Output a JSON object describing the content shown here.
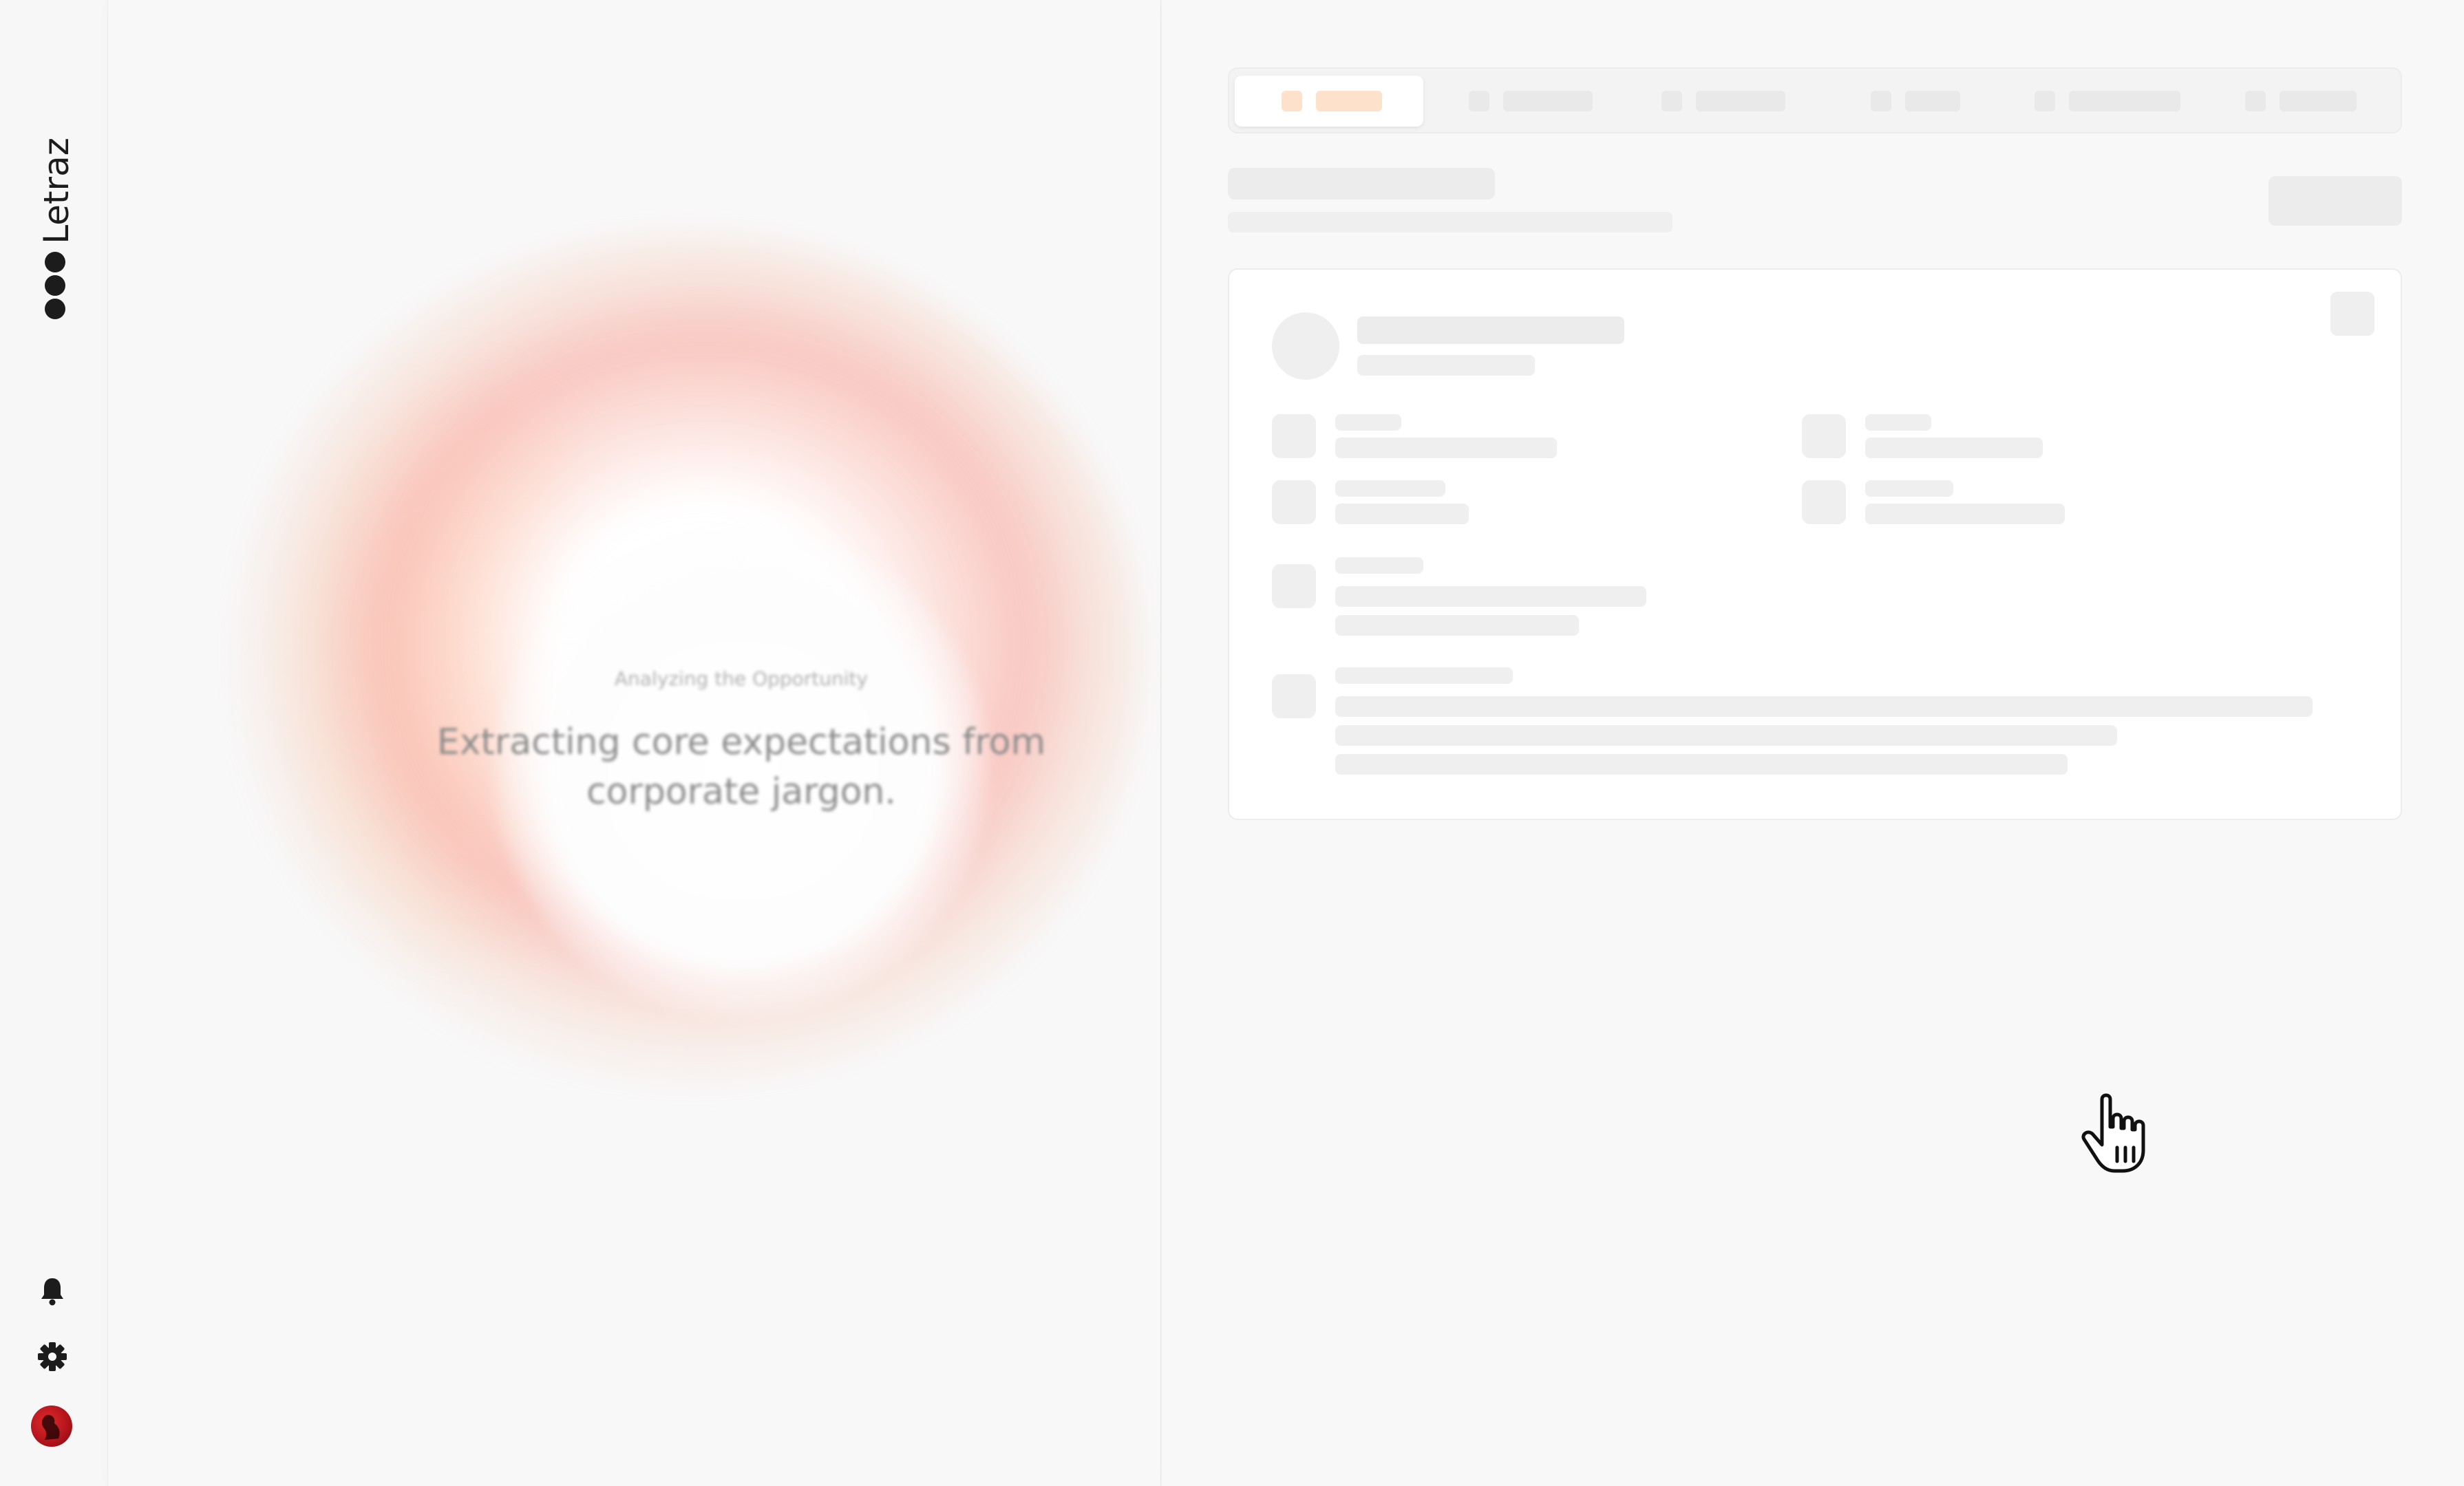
{
  "app": {
    "brand": "Letraz"
  },
  "rail": {
    "icons": [
      "bell-icon",
      "gear-icon",
      "avatar"
    ]
  },
  "loader": {
    "subtitle": "Analyzing the Opportunity",
    "message": "Extracting core expectations from corporate jargon."
  },
  "tabs": {
    "count": 6,
    "active_index": 0
  },
  "colors": {
    "accent": "#fde1cb",
    "halo": "#f9a9a0",
    "skeleton": "#ececec",
    "avatar": "#c8161f"
  }
}
